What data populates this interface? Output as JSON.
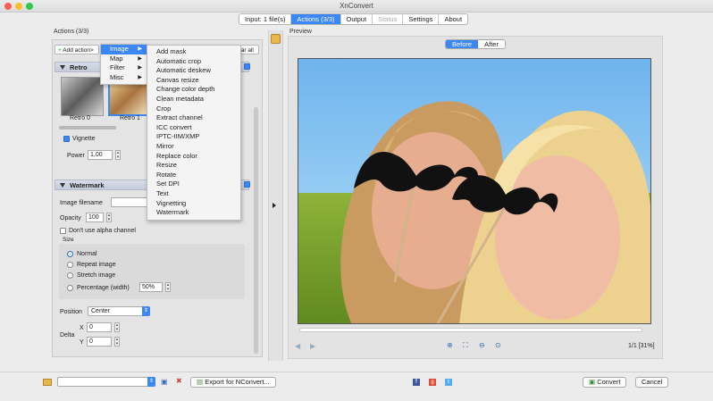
{
  "window": {
    "title": "XnConvert"
  },
  "tabs": [
    {
      "label": "Input: 1 file(s)",
      "state": "normal"
    },
    {
      "label": "Actions (3/3)",
      "state": "active"
    },
    {
      "label": "Output",
      "state": "normal"
    },
    {
      "label": "Status",
      "state": "disabled"
    },
    {
      "label": "Settings",
      "state": "normal"
    },
    {
      "label": "About",
      "state": "normal"
    }
  ],
  "actions": {
    "section_label": "Actions (3/3)",
    "add_action": "Add action>",
    "clear_all": "Clear all",
    "retro": {
      "title": "Retro",
      "thumbs": [
        "Retro 0",
        "Retro 1"
      ],
      "vignette_label": "Vignette",
      "power_label": "Power",
      "power_value": "1,00"
    },
    "watermark": {
      "title": "Watermark",
      "image_filename_label": "Image filename",
      "opacity_label": "Opacity",
      "opacity_value": "100",
      "alpha_label": "Don't use alpha channel",
      "size_label": "Size",
      "size_options": [
        "Normal",
        "Repeat image",
        "Stretch image",
        "Percentage (width)"
      ],
      "percentage_value": "50%",
      "position_label": "Position",
      "position_value": "Center",
      "delta_label": "Delta",
      "x_label": "X",
      "x_value": "0",
      "y_label": "Y",
      "y_value": "0"
    }
  },
  "menu": {
    "categories": [
      "Image",
      "Map",
      "Filter",
      "Misc"
    ],
    "image_items": [
      "Add mask",
      "Automatic crop",
      "Automatic deskew",
      "Canvas resize",
      "Change color depth",
      "Clean metadata",
      "Crop",
      "Extract channel",
      "ICC convert",
      "IPTC-IIM/XMP",
      "Mirror",
      "Replace color",
      "Resize",
      "Rotate",
      "Set DPI",
      "Text",
      "Vignetting",
      "Watermark"
    ]
  },
  "preview": {
    "section_label": "Preview",
    "before_label": "Before",
    "after_label": "After",
    "page_info": "1/1 [31%]"
  },
  "bottom": {
    "export_label": "Export for NConvert...",
    "convert_label": "Convert",
    "cancel_label": "Cancel"
  },
  "colors": {
    "accent": "#3b87f5",
    "close": "#fc5f57",
    "minimize": "#fdbc2e",
    "zoom": "#34c84a"
  }
}
